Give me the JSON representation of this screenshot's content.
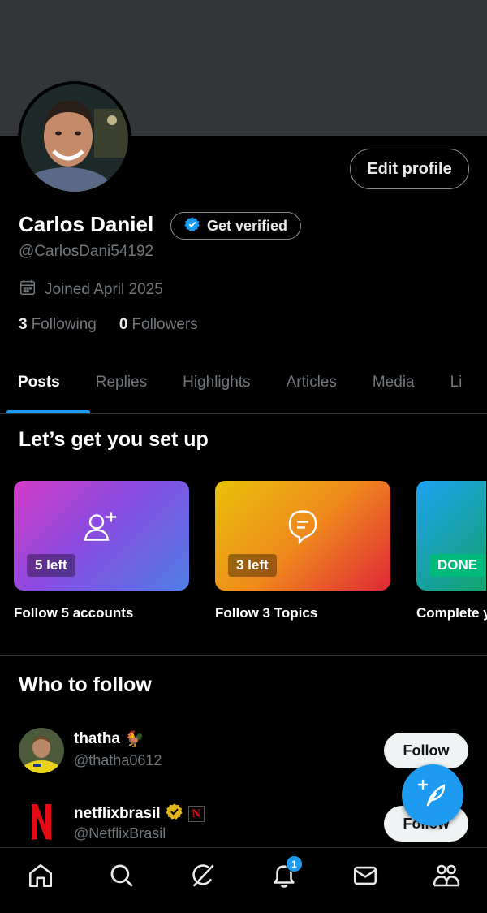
{
  "profile": {
    "name": "Carlos Daniel",
    "handle": "@CarlosDani54192",
    "joined": "Joined April 2025",
    "following_count": "3",
    "following_label": "Following",
    "followers_count": "0",
    "followers_label": "Followers",
    "edit_label": "Edit profile",
    "verify_label": "Get verified"
  },
  "tabs": [
    {
      "label": "Posts",
      "active": true
    },
    {
      "label": "Replies"
    },
    {
      "label": "Highlights"
    },
    {
      "label": "Articles"
    },
    {
      "label": "Media"
    },
    {
      "label": "Li"
    }
  ],
  "setup": {
    "title": "Let’s get you set up",
    "cards": [
      {
        "badge": "5 left",
        "label": "Follow 5 accounts",
        "icon": "add-user-icon"
      },
      {
        "badge": "3 left",
        "label": "Follow 3 Topics",
        "icon": "topic-bubble-icon"
      },
      {
        "badge": "DONE",
        "label": "Complete y",
        "icon": "none"
      }
    ]
  },
  "who_to_follow": {
    "title": "Who to follow",
    "users": [
      {
        "name": "thatha",
        "emoji": "🐓",
        "handle": "@thatha0612",
        "button": "Follow"
      },
      {
        "name": "netflixbrasil",
        "handle": "@NetflixBrasil",
        "button": "Follow",
        "logo_letter": "N"
      }
    ]
  },
  "nav": {
    "items": [
      "home-icon",
      "search-icon",
      "grok-icon",
      "notifications-icon",
      "messages-icon",
      "communities-icon"
    ],
    "notification_count": "1"
  },
  "colors": {
    "accent": "#1d9bf0",
    "gold": "#e2b719",
    "netflix_red": "#e50914"
  }
}
